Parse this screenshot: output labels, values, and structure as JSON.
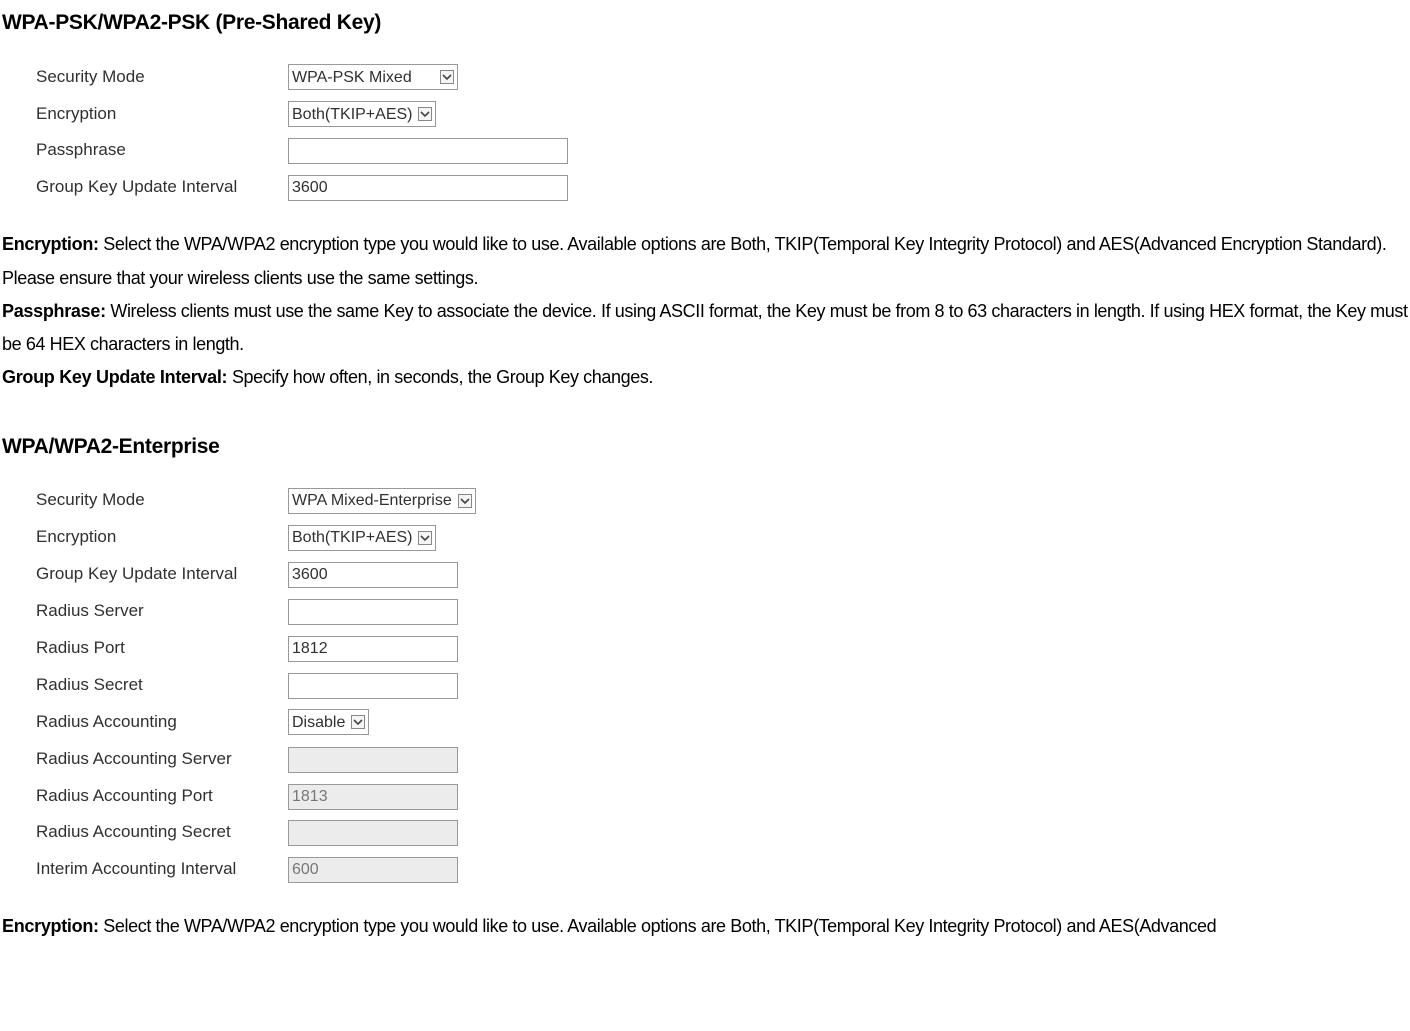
{
  "section1": {
    "heading": "WPA-PSK/WPA2-PSK (Pre-Shared Key)",
    "rows": {
      "security_mode_label": "Security Mode",
      "security_mode_value": "WPA-PSK Mixed",
      "encryption_label": "Encryption",
      "encryption_value": "Both(TKIP+AES)",
      "passphrase_label": "Passphrase",
      "passphrase_value": "",
      "gkui_label": "Group Key Update Interval",
      "gkui_value": "3600"
    },
    "desc": {
      "encryption_b": "Encryption:",
      "encryption_t": " Select the WPA/WPA2 encryption type you would like to use. Available options are Both, TKIP(Temporal Key Integrity Protocol) and AES(Advanced Encryption Standard). Please ensure that your wireless clients use the same settings.",
      "passphrase_b": "Passphrase:",
      "passphrase_t": " Wireless clients must use the same Key to associate the device. If using ASCII format, the Key must be from 8 to 63 characters in length. If using HEX format, the Key must be 64 HEX characters in length.",
      "gkui_b": "Group Key Update Interval: ",
      "gkui_t": "Specify how often, in seconds, the Group Key changes."
    }
  },
  "section2": {
    "heading": "WPA/WPA2-Enterprise",
    "rows": {
      "security_mode_label": "Security Mode",
      "security_mode_value": "WPA Mixed-Enterprise",
      "encryption_label": "Encryption",
      "encryption_value": "Both(TKIP+AES)",
      "gkui_label": "Group Key Update Interval",
      "gkui_value": "3600",
      "radius_server_label": "Radius Server",
      "radius_server_value": "",
      "radius_port_label": "Radius Port",
      "radius_port_value": "1812",
      "radius_secret_label": "Radius Secret",
      "radius_secret_value": "",
      "radius_acct_label": "Radius Accounting",
      "radius_acct_value": "Disable",
      "radius_acct_server_label": "Radius Accounting Server",
      "radius_acct_server_value": "",
      "radius_acct_port_label": "Radius Accounting Port",
      "radius_acct_port_value": "1813",
      "radius_acct_secret_label": "Radius Accounting Secret",
      "radius_acct_secret_value": "",
      "interim_label": "Interim Accounting Interval",
      "interim_value": "600"
    },
    "desc": {
      "encryption_b": "Encryption:",
      "encryption_t": " Select the WPA/WPA2 encryption type you would like to use. Available options are Both, TKIP(Temporal Key Integrity Protocol) and AES(Advanced"
    }
  }
}
